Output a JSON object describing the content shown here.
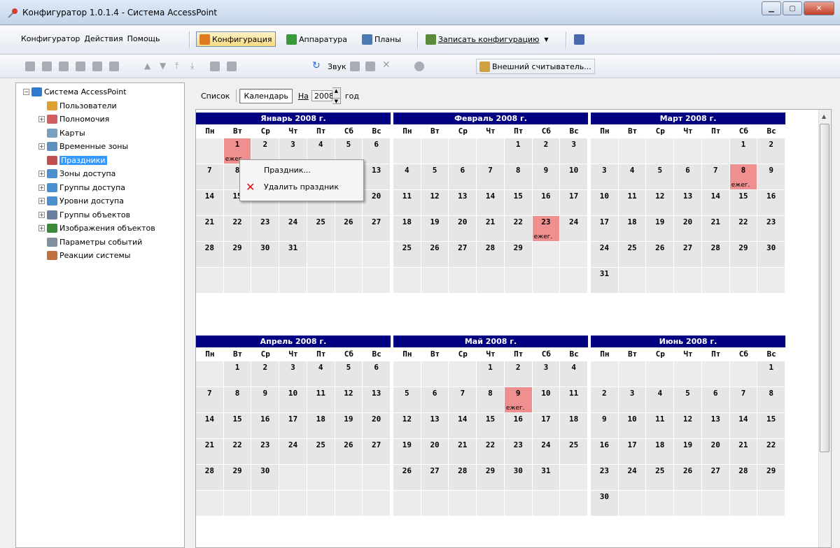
{
  "window": {
    "title": "Конфигуратор 1.0.1.4 - Система AccessPoint",
    "buttons": [
      "▁",
      "▢",
      "✕"
    ]
  },
  "menu": [
    "Конфигуратор",
    "Действия",
    "Помощь"
  ],
  "toolbar1": {
    "config_label": "Конфигурация",
    "hardware_label": "Аппаратура",
    "plans_label": "Планы",
    "write_label": "Записать конфигурацию",
    "write_arrow": "▼"
  },
  "toolbar2": {
    "sound_label": "Звук",
    "reader_label": "Внешний считыватель..."
  },
  "tree": [
    {
      "label": "Система AccessPoint",
      "expander": "−",
      "color": "#2e7bd0"
    },
    {
      "label": "Пользователи",
      "expander": "",
      "color": "#e0a030"
    },
    {
      "label": "Полномочия",
      "expander": "+",
      "color": "#d06060"
    },
    {
      "label": "Карты",
      "expander": "",
      "color": "#7aa0c0"
    },
    {
      "label": "Временные зоны",
      "expander": "+",
      "color": "#6090c0"
    },
    {
      "label": "Праздники",
      "expander": "",
      "color": "#c05050",
      "selected": true
    },
    {
      "label": "Зоны доступа",
      "expander": "+",
      "color": "#4a90d0"
    },
    {
      "label": "Группы доступа",
      "expander": "+",
      "color": "#4a90d0"
    },
    {
      "label": "Уровни доступа",
      "expander": "+",
      "color": "#4a90d0"
    },
    {
      "label": "Группы объектов",
      "expander": "+",
      "color": "#6a7fa0"
    },
    {
      "label": "Изображения объектов",
      "expander": "+",
      "color": "#3a8a3a"
    },
    {
      "label": "Параметры событий",
      "expander": "",
      "color": "#8090a0"
    },
    {
      "label": "Реакции системы",
      "expander": "",
      "color": "#c07040"
    }
  ],
  "view": {
    "list_label": "Список",
    "calendar_label": "Календарь",
    "on_label": "На",
    "year": "2008",
    "year_suffix": "год"
  },
  "calendar": {
    "weekdays": [
      "Пн",
      "Вт",
      "Ср",
      "Чт",
      "Пт",
      "Сб",
      "Вс"
    ],
    "months": [
      {
        "title": "Январь 2008 г.",
        "offset": 1,
        "days": 31,
        "holidays": [
          {
            "day": 1,
            "note": "ежег."
          }
        ]
      },
      {
        "title": "Февраль 2008 г.",
        "offset": 4,
        "days": 29,
        "holidays": [
          {
            "day": 23,
            "note": "ежег."
          }
        ]
      },
      {
        "title": "Март 2008 г.",
        "offset": 5,
        "days": 31,
        "holidays": [
          {
            "day": 8,
            "note": "ежег."
          }
        ]
      },
      {
        "title": "Апрель 2008 г.",
        "offset": 1,
        "days": 30,
        "holidays": []
      },
      {
        "title": "Май 2008 г.",
        "offset": 3,
        "days": 31,
        "holidays": [
          {
            "day": 9,
            "note": "ежег."
          }
        ]
      },
      {
        "title": "Июнь 2008 г.",
        "offset": 6,
        "days": 30,
        "holidays": []
      }
    ]
  },
  "context_menu": {
    "item1": "Праздник...",
    "item2": "Удалить праздник"
  }
}
